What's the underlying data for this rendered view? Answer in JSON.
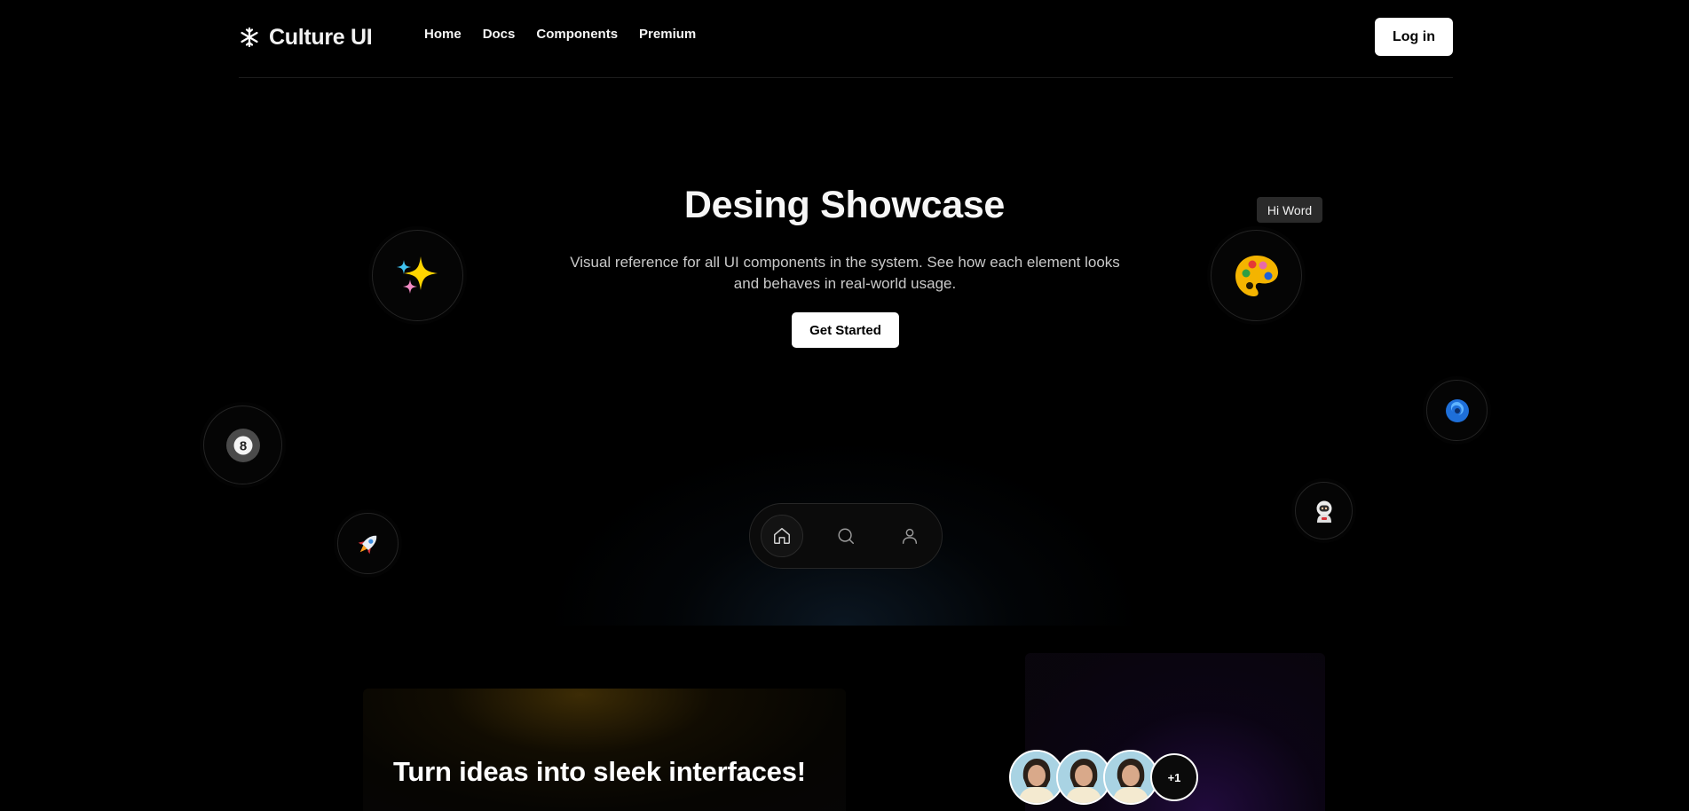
{
  "header": {
    "brand_name": "Culture UI",
    "brand_icon": "snowflake-logo-icon",
    "nav": [
      {
        "label": "Home"
      },
      {
        "label": "Docs"
      },
      {
        "label": "Components"
      },
      {
        "label": "Premium"
      }
    ],
    "login_label": "Log in"
  },
  "hero": {
    "title": "Desing Showcase",
    "subtitle": "Visual reference for all UI components in the system. See how each element looks and behaves in real-world usage.",
    "cta_label": "Get Started",
    "tooltip": "Hi Word",
    "bubbles": [
      "sparkles-emoji",
      "artist-palette-emoji",
      "pool-8-ball-emoji",
      "rocket-emoji",
      "cyclone-emoji",
      "astronaut-emoji"
    ]
  },
  "dock": {
    "items": [
      {
        "icon": "home-icon",
        "active": true
      },
      {
        "icon": "search-icon",
        "active": false
      },
      {
        "icon": "user-icon",
        "active": false
      }
    ]
  },
  "section": {
    "card_title": "Turn ideas into sleek interfaces!",
    "avatar_more": "+1"
  },
  "colors": {
    "background": "#000000",
    "accent_button": "#ffffff",
    "tooltip_bg": "#2a2a2a"
  }
}
